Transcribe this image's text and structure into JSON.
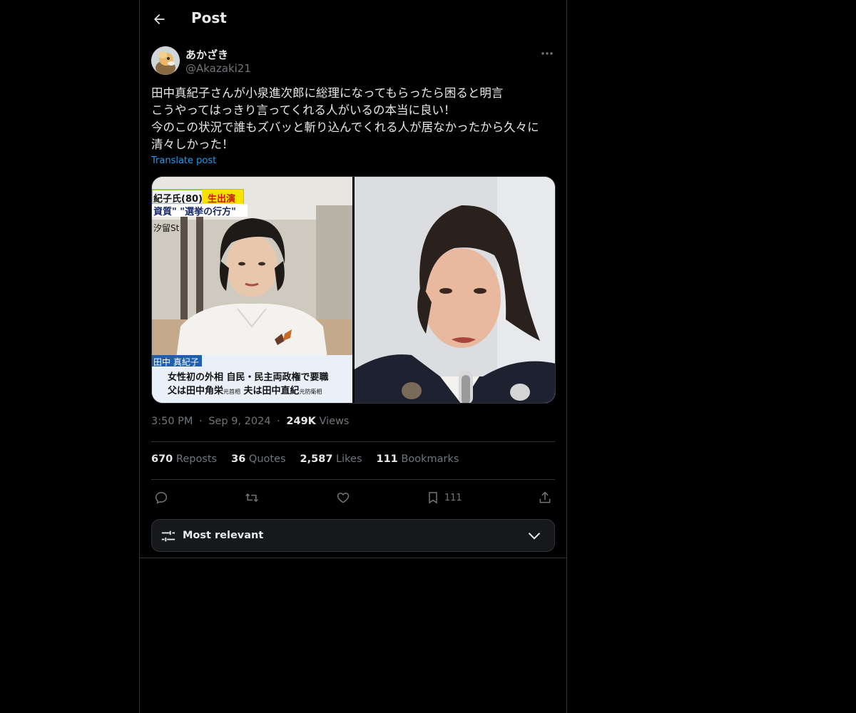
{
  "header": {
    "title": "Post",
    "back_icon": "arrow-left-icon"
  },
  "author": {
    "display_name": "あかざき",
    "handle": "@Akazaki21"
  },
  "post": {
    "text": "田中真紀子さんが小泉進次郎に総理になってもらったら困ると明言\nこうやってはっきり言ってくれる人がいるの本当に良い！\n今のこの状況で誰もズバッと斬り込んでくれる人が居なかったから久々に清々しかった！",
    "translate_label": "Translate post",
    "time": "3:50 PM",
    "date": "Sep 9, 2024",
    "separator": "·",
    "views_count": "249K",
    "views_label": "Views"
  },
  "media": {
    "left": {
      "banner_name": "紀子氏(80)",
      "banner_live": "生出演",
      "banner_topic": "資質\" \"選挙の行方\"",
      "station": "汐留St",
      "caption_name": "田中 真紀子",
      "caption_line1": "女性初の外相 自民・民主両政権で要職",
      "caption_line2_a": "父は田中角栄",
      "caption_line2_a_sub": "元首相",
      "caption_line2_b": "夫は田中直紀",
      "caption_line2_b_sub": "元防衛相"
    }
  },
  "stats": [
    {
      "count": "670",
      "label": "Reposts"
    },
    {
      "count": "36",
      "label": "Quotes"
    },
    {
      "count": "2,587",
      "label": "Likes"
    },
    {
      "count": "111",
      "label": "Bookmarks"
    }
  ],
  "actions": {
    "reply_icon": "reply-icon",
    "repost_icon": "repost-icon",
    "like_icon": "heart-icon",
    "bookmark_icon": "bookmark-icon",
    "bookmark_count": "111",
    "share_icon": "share-icon"
  },
  "sort": {
    "label": "Most relevant"
  },
  "colors": {
    "background": "#000000",
    "text": "#e7e9ea",
    "muted": "#71767b",
    "accent": "#1d9bf0",
    "border": "#2f3336"
  }
}
